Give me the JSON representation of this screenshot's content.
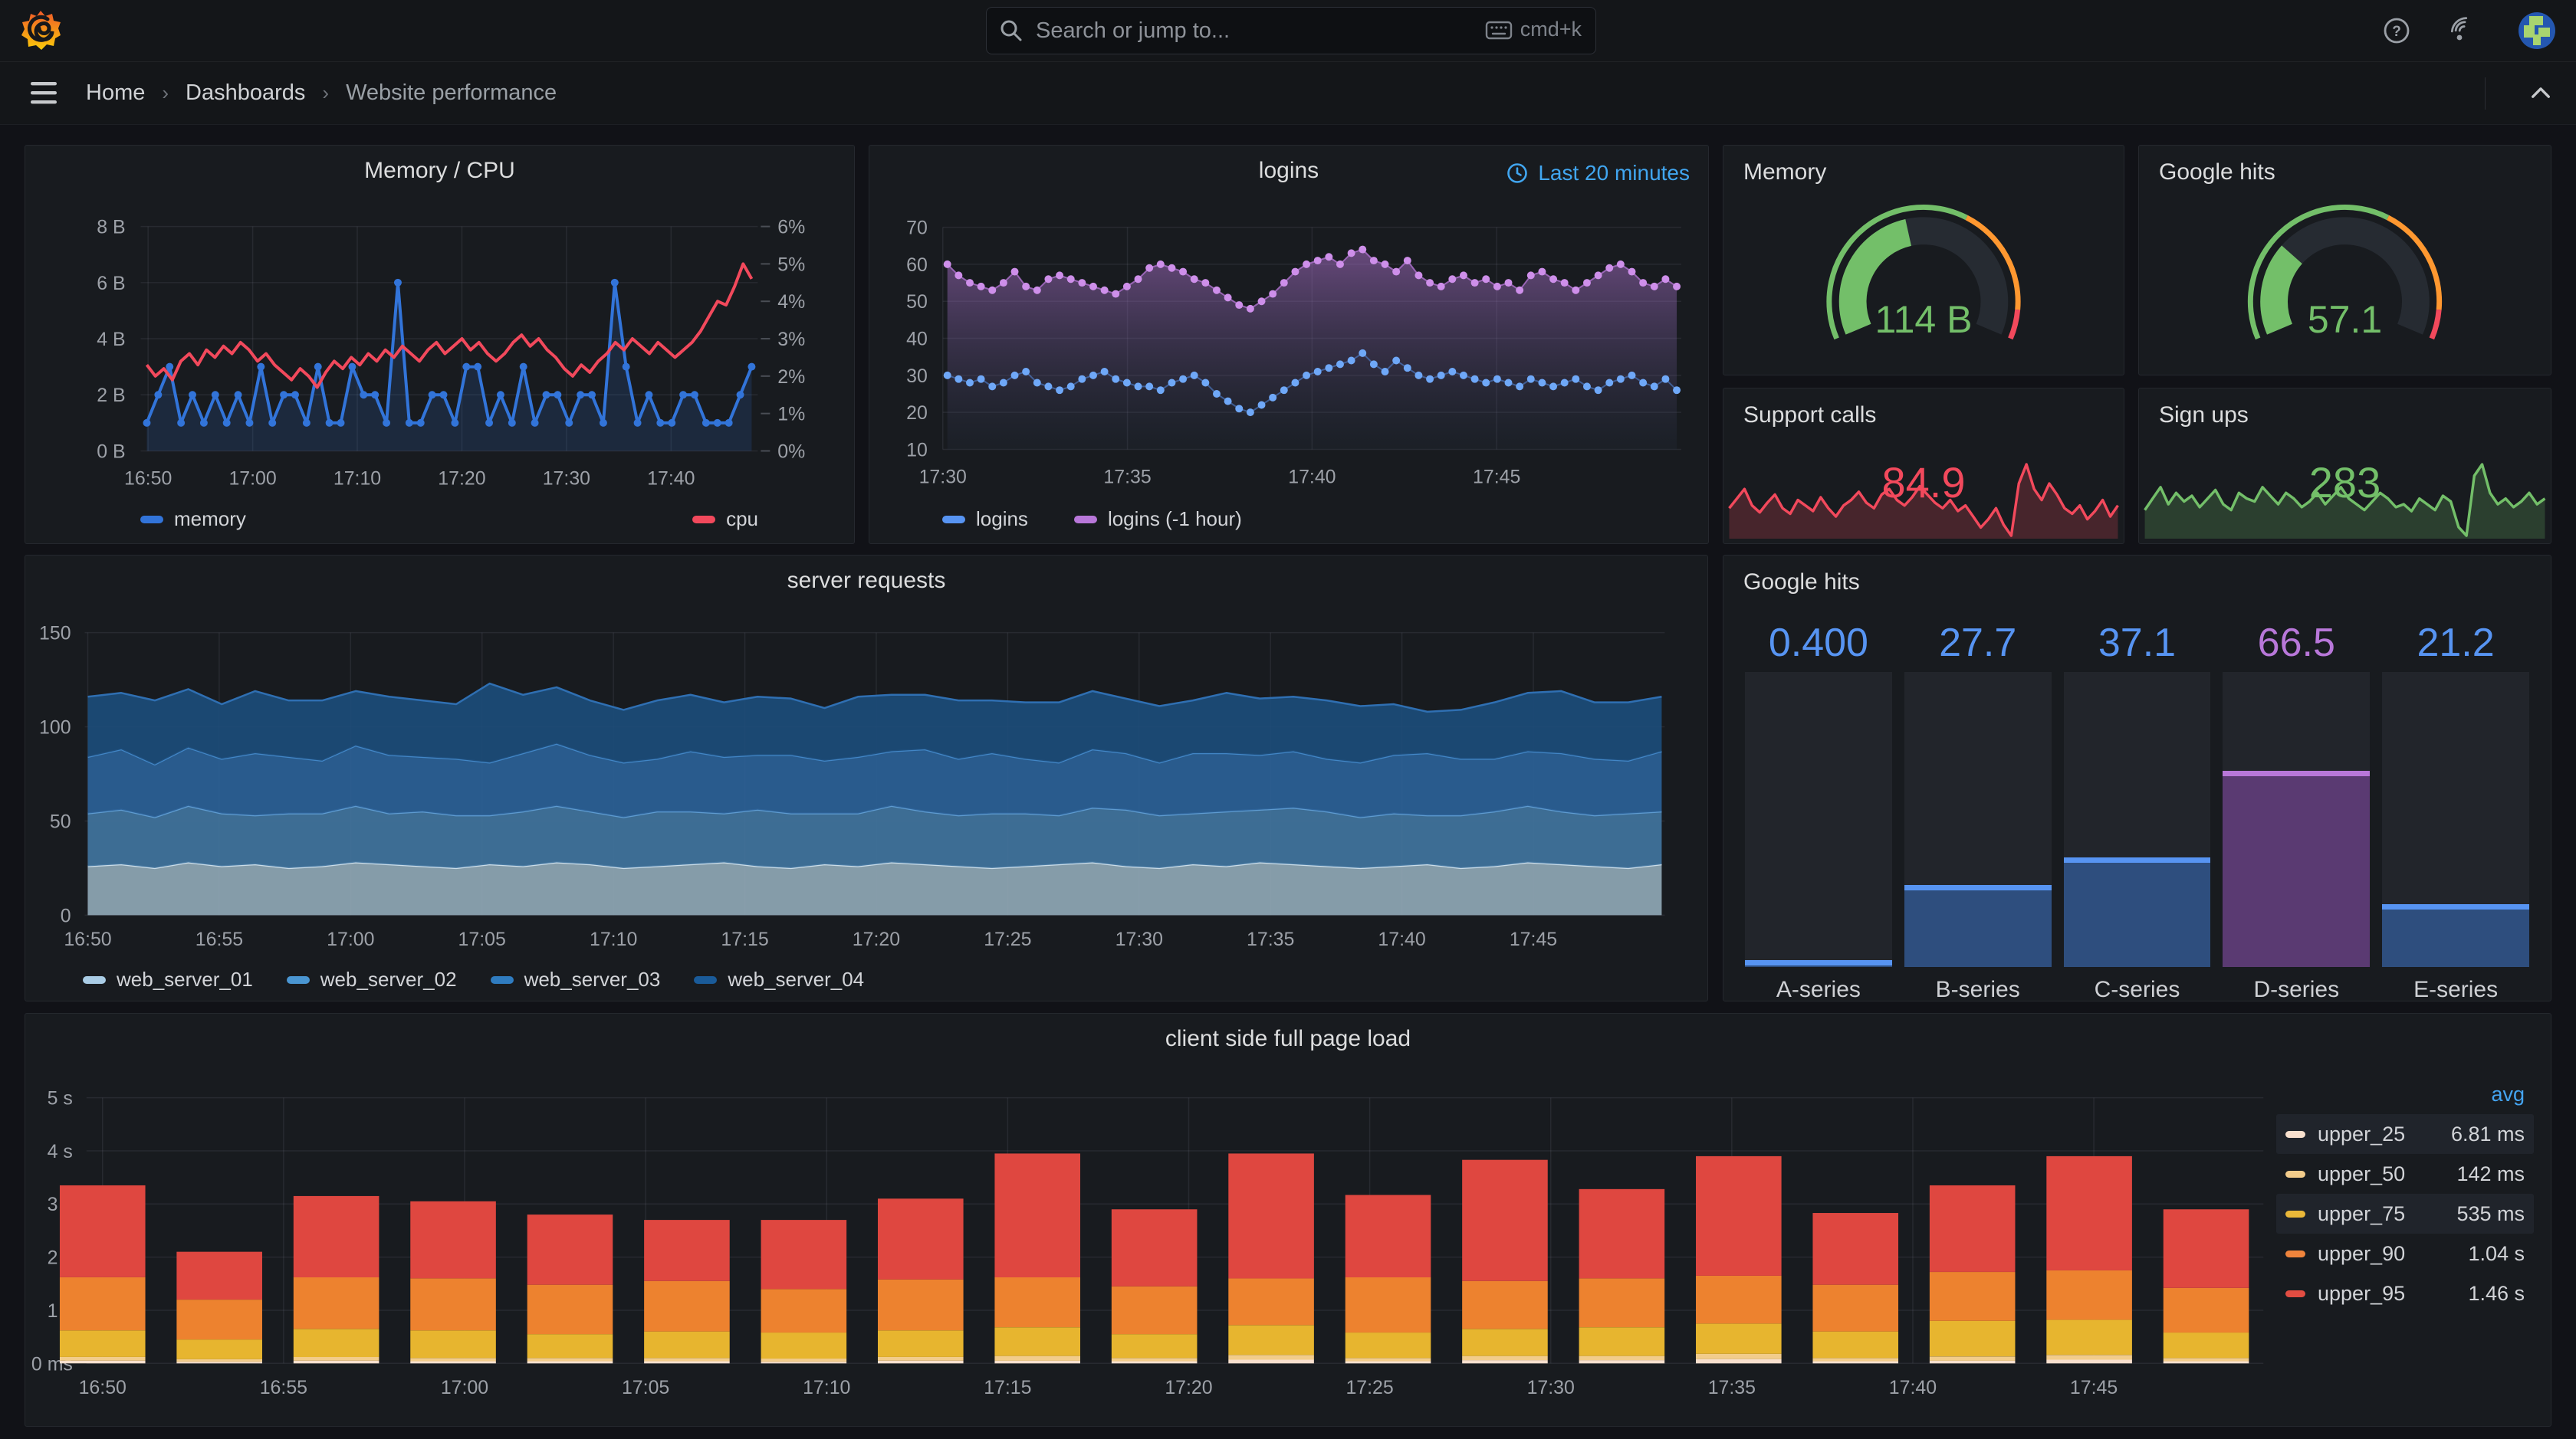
{
  "topnav": {
    "search_placeholder": "Search or jump to...",
    "shortcut_label": "cmd+k"
  },
  "breadcrumb": {
    "home": "Home",
    "dashboards": "Dashboards",
    "current": "Website performance"
  },
  "panels": {
    "memory_cpu": {
      "title": "Memory / CPU",
      "chart_data": {
        "type": "line",
        "x_ticks": [
          "16:50",
          "17:00",
          "17:10",
          "17:20",
          "17:30",
          "17:40"
        ],
        "y_left_ticks": [
          "0 B",
          "2 B",
          "4 B",
          "6 B",
          "8 B"
        ],
        "y_right_ticks": [
          "0%",
          "1%",
          "2%",
          "3%",
          "4%",
          "5%",
          "6%"
        ],
        "y_left_range": [
          0,
          8
        ],
        "y_right_range": [
          0,
          6
        ],
        "series": [
          {
            "name": "memory",
            "color": "#3274D9",
            "axis": "left",
            "values": [
              1,
              2,
              3,
              1,
              2,
              1,
              2,
              1,
              2,
              1,
              3,
              1,
              2,
              2,
              1,
              3,
              1,
              1,
              3,
              2,
              2,
              1,
              6,
              1,
              1,
              2,
              2,
              1,
              3,
              3,
              1,
              2,
              1,
              3,
              1,
              2,
              2,
              1,
              2,
              2,
              1,
              6,
              3,
              1,
              2,
              1,
              1,
              2,
              2,
              1,
              1,
              1,
              2,
              3
            ]
          },
          {
            "name": "cpu",
            "color": "#F2495C",
            "axis": "right",
            "values": [
              2.3,
              2.0,
              2.2,
              1.9,
              2.4,
              2.6,
              2.3,
              2.7,
              2.5,
              2.8,
              2.6,
              2.9,
              2.7,
              2.4,
              2.6,
              2.3,
              2.1,
              1.9,
              2.2,
              2.0,
              1.7,
              2.1,
              2.4,
              2.2,
              2.5,
              2.3,
              2.6,
              2.4,
              2.7,
              2.5,
              2.8,
              2.6,
              2.4,
              2.7,
              2.9,
              2.6,
              2.8,
              3.0,
              2.7,
              2.9,
              2.6,
              2.4,
              2.6,
              2.9,
              3.1,
              2.8,
              3.0,
              2.7,
              2.5,
              2.2,
              2.0,
              2.3,
              2.1,
              2.4,
              2.6,
              2.9,
              2.7,
              3.0,
              2.8,
              2.6,
              2.9,
              2.7,
              2.5,
              2.7,
              2.9,
              3.2,
              3.6,
              4.0,
              3.9,
              4.4,
              5.0,
              4.6
            ]
          }
        ]
      }
    },
    "logins": {
      "title": "logins",
      "time_range": "Last 20 minutes",
      "chart_data": {
        "type": "scatter",
        "x_ticks": [
          "17:30",
          "17:35",
          "17:40",
          "17:45"
        ],
        "y_ticks": [
          "10",
          "20",
          "30",
          "40",
          "50",
          "60",
          "70"
        ],
        "y_range": [
          10,
          70
        ],
        "series": [
          {
            "name": "logins",
            "color": "#5794F2",
            "values": [
              30,
              29,
              28,
              29,
              27,
              28,
              30,
              31,
              28,
              27,
              26,
              27,
              29,
              30,
              31,
              29,
              28,
              27,
              27,
              26,
              28,
              29,
              30,
              28,
              25,
              23,
              21,
              20,
              22,
              24,
              26,
              28,
              30,
              31,
              32,
              33,
              34,
              36,
              33,
              31,
              34,
              32,
              30,
              29,
              30,
              31,
              30,
              29,
              28,
              29,
              28,
              27,
              29,
              28,
              27,
              28,
              29,
              27,
              26,
              28,
              29,
              30,
              28,
              27,
              29,
              26
            ]
          },
          {
            "name": "logins (-1 hour)",
            "color": "#B877D9",
            "values": [
              60,
              57,
              55,
              54,
              53,
              55,
              58,
              54,
              53,
              56,
              57,
              56,
              55,
              54,
              53,
              52,
              54,
              56,
              59,
              60,
              59,
              58,
              56,
              55,
              53,
              51,
              49,
              48,
              50,
              52,
              55,
              58,
              60,
              61,
              62,
              60,
              63,
              64,
              61,
              60,
              58,
              61,
              57,
              55,
              54,
              56,
              57,
              55,
              56,
              54,
              55,
              53,
              57,
              58,
              56,
              55,
              53,
              55,
              57,
              59,
              60,
              58,
              55,
              54,
              56,
              54
            ]
          }
        ]
      }
    },
    "memory_gauge": {
      "title": "Memory",
      "value": "114 B",
      "fraction": 0.445,
      "value_color": "#73BF69",
      "thresholds": [
        {
          "to": 0.62,
          "color": "#73BF69"
        },
        {
          "to": 0.92,
          "color": "#FF9830"
        },
        {
          "to": 1,
          "color": "#F2495C"
        }
      ]
    },
    "google_hits_gauge": {
      "title": "Google hits",
      "value": "57.1",
      "fraction": 0.286,
      "value_color": "#73BF69",
      "thresholds": [
        {
          "to": 0.62,
          "color": "#73BF69"
        },
        {
          "to": 0.92,
          "color": "#FF9830"
        },
        {
          "to": 1,
          "color": "#F2495C"
        }
      ]
    },
    "support_calls": {
      "title": "Support calls",
      "value": "84.9",
      "color": "#F2495C",
      "chart_data": {
        "type": "area",
        "values": [
          78,
          85,
          92,
          80,
          75,
          82,
          88,
          78,
          74,
          84,
          80,
          76,
          86,
          78,
          72,
          80,
          84,
          90,
          82,
          78,
          88,
          92,
          84,
          80,
          86,
          94,
          88,
          82,
          78,
          84,
          76,
          80,
          72,
          64,
          70,
          78,
          66,
          58,
          96,
          110,
          92,
          84,
          96,
          88,
          78,
          74,
          80,
          70,
          76,
          84,
          72,
          80
        ]
      }
    },
    "sign_ups": {
      "title": "Sign ups",
      "value": "283",
      "color": "#73BF69",
      "chart_data": {
        "type": "area",
        "values": [
          230,
          250,
          270,
          240,
          260,
          245,
          255,
          235,
          250,
          265,
          240,
          230,
          260,
          250,
          245,
          270,
          255,
          240,
          260,
          250,
          235,
          245,
          260,
          240,
          255,
          270,
          250,
          240,
          230,
          245,
          260,
          250,
          235,
          240,
          228,
          250,
          240,
          230,
          255,
          245,
          200,
          185,
          290,
          310,
          260,
          240,
          250,
          235,
          245,
          260,
          240,
          250
        ]
      }
    },
    "server_requests": {
      "title": "server requests",
      "chart_data": {
        "type": "area-stacked",
        "x_ticks": [
          "16:50",
          "16:55",
          "17:00",
          "17:05",
          "17:10",
          "17:15",
          "17:20",
          "17:25",
          "17:30",
          "17:35",
          "17:40",
          "17:45"
        ],
        "y_ticks": [
          "0",
          "50",
          "100",
          "150"
        ],
        "y_max": 150,
        "series": [
          {
            "name": "web_server_01",
            "swatch": "#A9CCE5",
            "fill": "#8FA7B5",
            "line": "#CBDDE9",
            "values": [
              26,
              27,
              25,
              28,
              26,
              27,
              25,
              26,
              28,
              27,
              26,
              25,
              27,
              26,
              28,
              27,
              25,
              26,
              27,
              28,
              26,
              25,
              27,
              26,
              28,
              27,
              26,
              25,
              26,
              27,
              28,
              26,
              25,
              27,
              26,
              28,
              27,
              26,
              25,
              26,
              27,
              25,
              26,
              28,
              27,
              26,
              25,
              27
            ]
          },
          {
            "name": "web_server_02",
            "swatch": "#4A96D2",
            "fill": "#41749E",
            "line": "#5E9BD0",
            "values": [
              28,
              29,
              27,
              30,
              28,
              26,
              29,
              28,
              30,
              27,
              29,
              28,
              26,
              29,
              30,
              28,
              27,
              29,
              28,
              26,
              30,
              29,
              27,
              28,
              30,
              28,
              27,
              29,
              28,
              26,
              29,
              30,
              28,
              27,
              29,
              28,
              30,
              29,
              27,
              28,
              26,
              28,
              29,
              30,
              28,
              27,
              29,
              28
            ]
          },
          {
            "name": "web_server_03",
            "swatch": "#2F7CC0",
            "fill": "#2B6197",
            "line": "#4286C6",
            "values": [
              30,
              32,
              28,
              31,
              29,
              33,
              30,
              28,
              32,
              31,
              29,
              30,
              28,
              31,
              33,
              30,
              29,
              28,
              32,
              30,
              29,
              31,
              28,
              30,
              29,
              33,
              30,
              32,
              29,
              28,
              31,
              30,
              28,
              32,
              31,
              29,
              30,
              28,
              29,
              31,
              33,
              30,
              28,
              29,
              31,
              30,
              28,
              32
            ]
          },
          {
            "name": "web_server_04",
            "swatch": "#1A5B99",
            "fill": "#1C4C79",
            "line": "#2F6FB2",
            "values": [
              32,
              30,
              34,
              31,
              29,
              33,
              30,
              32,
              29,
              31,
              30,
              29,
              42,
              31,
              30,
              29,
              28,
              31,
              30,
              29,
              31,
              30,
              28,
              32,
              30,
              29,
              31,
              28,
              30,
              32,
              31,
              29,
              30,
              28,
              32,
              30,
              29,
              31,
              30,
              27,
              22,
              26,
              30,
              31,
              33,
              30,
              31,
              29
            ]
          }
        ]
      }
    },
    "google_hits_bars": {
      "title": "Google hits",
      "chart_data": {
        "type": "bar",
        "categories": [
          "A-series",
          "B-series",
          "C-series",
          "D-series",
          "E-series"
        ],
        "values": [
          0.4,
          27.7,
          37.1,
          66.5,
          21.2
        ],
        "display_values": [
          "0.400",
          "27.7",
          "37.1",
          "66.5",
          "21.2"
        ],
        "max": 100,
        "bar_colors": [
          "#5794F2",
          "#5794F2",
          "#5794F2",
          "#B877D9",
          "#5794F2"
        ],
        "fill_colors": [
          "#2E4E7E",
          "#2E4E7E",
          "#2E4E7E",
          "#5A3A72",
          "#2E4E7E"
        ]
      }
    },
    "client_load": {
      "title": "client side full page load",
      "chart_data": {
        "type": "bar-stacked",
        "x_ticks": [
          "16:50",
          "16:55",
          "17:00",
          "17:05",
          "17:10",
          "17:15",
          "17:20",
          "17:25",
          "17:30",
          "17:35",
          "17:40",
          "17:45"
        ],
        "y_ticks": [
          "0 ms",
          "1 s",
          "2 s",
          "3 s",
          "4 s",
          "5 s"
        ],
        "y_max": 5,
        "series_names": [
          "upper_25",
          "upper_50",
          "upper_75",
          "upper_90",
          "upper_95"
        ],
        "series_colors": [
          "#F8E0CE",
          "#F2CC8B",
          "#E7B52F",
          "#ED822F",
          "#DF4740"
        ],
        "bars_cumulative": [
          [
            0.05,
            0.12,
            0.62,
            1.62,
            3.35
          ],
          [
            0.03,
            0.08,
            0.45,
            1.2,
            2.1
          ],
          [
            0.05,
            0.12,
            0.65,
            1.62,
            3.15
          ],
          [
            0.04,
            0.1,
            0.62,
            1.6,
            3.05
          ],
          [
            0.04,
            0.1,
            0.55,
            1.48,
            2.8
          ],
          [
            0.04,
            0.1,
            0.6,
            1.55,
            2.7
          ],
          [
            0.03,
            0.09,
            0.58,
            1.4,
            2.7
          ],
          [
            0.05,
            0.12,
            0.62,
            1.58,
            3.1
          ],
          [
            0.05,
            0.14,
            0.68,
            1.62,
            3.95
          ],
          [
            0.04,
            0.1,
            0.55,
            1.45,
            2.9
          ],
          [
            0.07,
            0.16,
            0.72,
            1.6,
            3.95
          ],
          [
            0.04,
            0.1,
            0.58,
            1.62,
            3.17
          ],
          [
            0.06,
            0.14,
            0.65,
            1.55,
            3.83
          ],
          [
            0.06,
            0.14,
            0.68,
            1.6,
            3.28
          ],
          [
            0.08,
            0.18,
            0.75,
            1.65,
            3.9
          ],
          [
            0.04,
            0.1,
            0.6,
            1.48,
            2.83
          ],
          [
            0.05,
            0.13,
            0.8,
            1.72,
            3.35
          ],
          [
            0.07,
            0.16,
            0.82,
            1.75,
            3.9
          ],
          [
            0.04,
            0.1,
            0.58,
            1.42,
            2.9
          ]
        ]
      },
      "legend": {
        "header": "avg",
        "rows": [
          {
            "label": "upper_25",
            "value": "6.81 ms",
            "color": "#F8E0CE"
          },
          {
            "label": "upper_50",
            "value": "142 ms",
            "color": "#F2CC8B"
          },
          {
            "label": "upper_75",
            "value": "535 ms",
            "color": "#EAB839"
          },
          {
            "label": "upper_90",
            "value": "1.04 s",
            "color": "#EF843C"
          },
          {
            "label": "upper_95",
            "value": "1.46 s",
            "color": "#E24D42"
          }
        ]
      }
    }
  }
}
